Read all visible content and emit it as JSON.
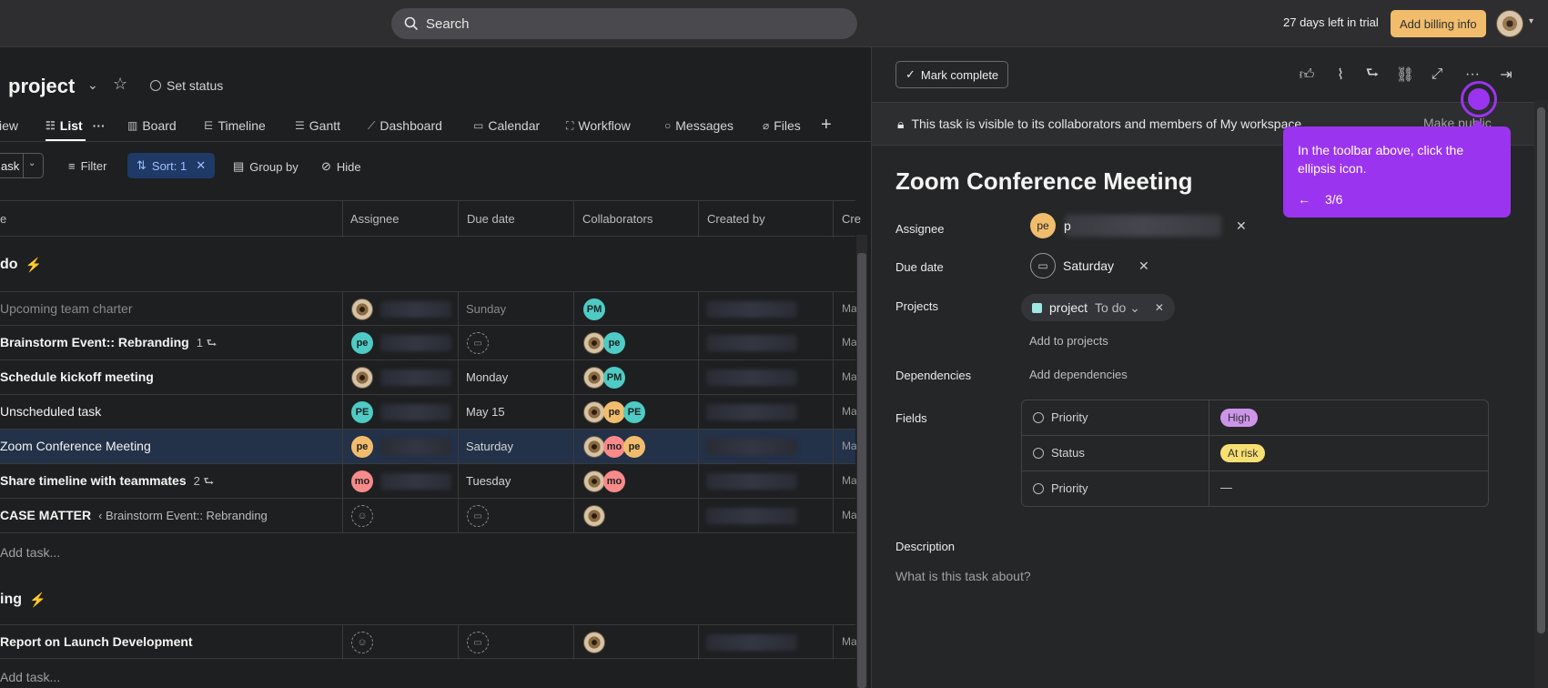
{
  "topbar": {
    "search_placeholder": "Search",
    "trial_text": "27 days left in trial",
    "billing_label": "Add billing info"
  },
  "project": {
    "title": "project",
    "set_status": "Set status"
  },
  "tabs": [
    {
      "label": "view",
      "icon": "overview-icon"
    },
    {
      "label": "List",
      "icon": "list-icon"
    },
    {
      "label": "Board",
      "icon": "board-icon"
    },
    {
      "label": "Timeline",
      "icon": "timeline-icon"
    },
    {
      "label": "Gantt",
      "icon": "gantt-icon"
    },
    {
      "label": "Dashboard",
      "icon": "dashboard-icon"
    },
    {
      "label": "Calendar",
      "icon": "calendar-icon"
    },
    {
      "label": "Workflow",
      "icon": "workflow-icon"
    },
    {
      "label": "Messages",
      "icon": "messages-icon"
    },
    {
      "label": "Files",
      "icon": "files-icon"
    }
  ],
  "toolbar": {
    "add_task": "ask",
    "filter": "Filter",
    "sort": "Sort: 1",
    "group_by": "Group by",
    "hide": "Hide"
  },
  "columns": {
    "name": "e",
    "assignee": "Assignee",
    "due_date": "Due date",
    "collaborators": "Collaborators",
    "created_by": "Created by",
    "cut": "Cre"
  },
  "sections": [
    {
      "title": "do",
      "add_task": "Add task...",
      "rows": [
        {
          "name": "Upcoming team charter",
          "due": "Sunday",
          "cut": "Ma"
        },
        {
          "name": "Brainstorm Event:: Rebranding",
          "subtasks": "1",
          "assignee_initials": "pe",
          "cut": "Ma"
        },
        {
          "name": "Schedule kickoff meeting",
          "due": "Monday",
          "collab_initials": "PM",
          "cut": "Ma"
        },
        {
          "name": "Unscheduled task",
          "assignee_initials": "PE",
          "due": "May 15",
          "collab_initials_a": "pe",
          "collab_initials_b": "PE",
          "cut": "Ma"
        },
        {
          "name": "Zoom Conference Meeting",
          "assignee_initials": "pe",
          "due": "Saturday",
          "collab_initials_a": "mo",
          "collab_initials_b": "pe",
          "cut": "Ma"
        },
        {
          "name": "Share timeline with teammates",
          "subtasks": "2",
          "assignee_initials": "mo",
          "due": "Tuesday",
          "collab_initials": "mo",
          "cut": "Ma"
        },
        {
          "name": "CASE MATTER",
          "parent": "‹ Brainstorm Event:: Rebranding",
          "cut": "Ma"
        }
      ],
      "first_row_collab": "PM"
    },
    {
      "title": "ing",
      "add_task": "Add task...",
      "rows": [
        {
          "name": "Report on Launch Development",
          "cut": "Ma"
        }
      ]
    }
  ],
  "detail": {
    "mark_complete": "Mark complete",
    "visibility_text": "This task is visible to its collaborators and members of My workspace",
    "make_public": "Make public",
    "task_title": "Zoom Conference Meeting",
    "assignee_label": "Assignee",
    "assignee_initials": "pe",
    "assignee_name_visible": "p",
    "due_label": "Due date",
    "due_value": "Saturday",
    "projects_label": "Projects",
    "project_name": "project",
    "project_section": "To do",
    "add_to_projects": "Add to projects",
    "dependencies_label": "Dependencies",
    "add_dependencies": "Add dependencies",
    "fields_label": "Fields",
    "fields": [
      {
        "label": "Priority",
        "value": "High",
        "color": "#cd95ea"
      },
      {
        "label": "Status",
        "value": "At risk",
        "color": "#f8df72"
      },
      {
        "label": "Priority",
        "value": "—"
      }
    ],
    "description_label": "Description",
    "description_placeholder": "What is this task about?"
  },
  "tooltip": {
    "text": "In the toolbar above, click the ellipsis icon.",
    "back": "←",
    "step": "3/6"
  },
  "colors": {
    "accent": "#9b34ef",
    "billing": "#f1bd6c",
    "selected_row": "#233149"
  }
}
